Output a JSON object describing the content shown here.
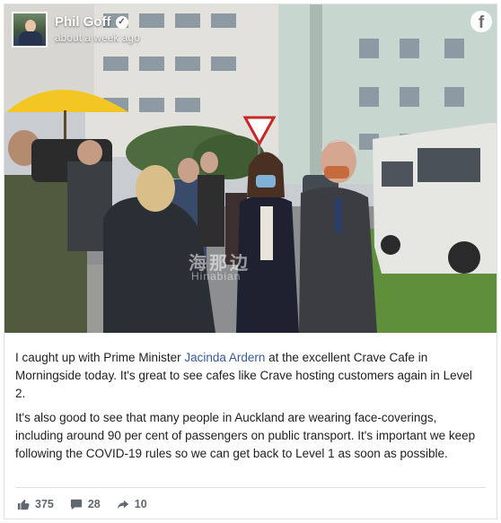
{
  "post": {
    "author": "Phil Goff",
    "verified_icon": "verified-badge-icon",
    "time": "about a week ago",
    "platform_icon": "facebook-icon",
    "paragraph1_before": "I caught up with Prime Minister ",
    "paragraph1_link": "Jacinda Ardern",
    "paragraph1_after": " at the excellent Crave Cafe in Morningside today. It's great to see cafes like Crave hosting customers again in Level 2.",
    "paragraph2": "It's also good to see that many people in Auckland are wearing face-coverings, including around 90 per cent of passengers on public transport. It's important we keep following the COVID-19 rules so we can get back to Level 1 as soon as possible."
  },
  "photo": {
    "watermark_cn": "海那边",
    "watermark_en": "Hinabian"
  },
  "actions": {
    "likes": "375",
    "comments": "28",
    "shares": "10"
  },
  "colors": {
    "link": "#385898",
    "text": "#1c1e21",
    "muted": "#606770"
  }
}
